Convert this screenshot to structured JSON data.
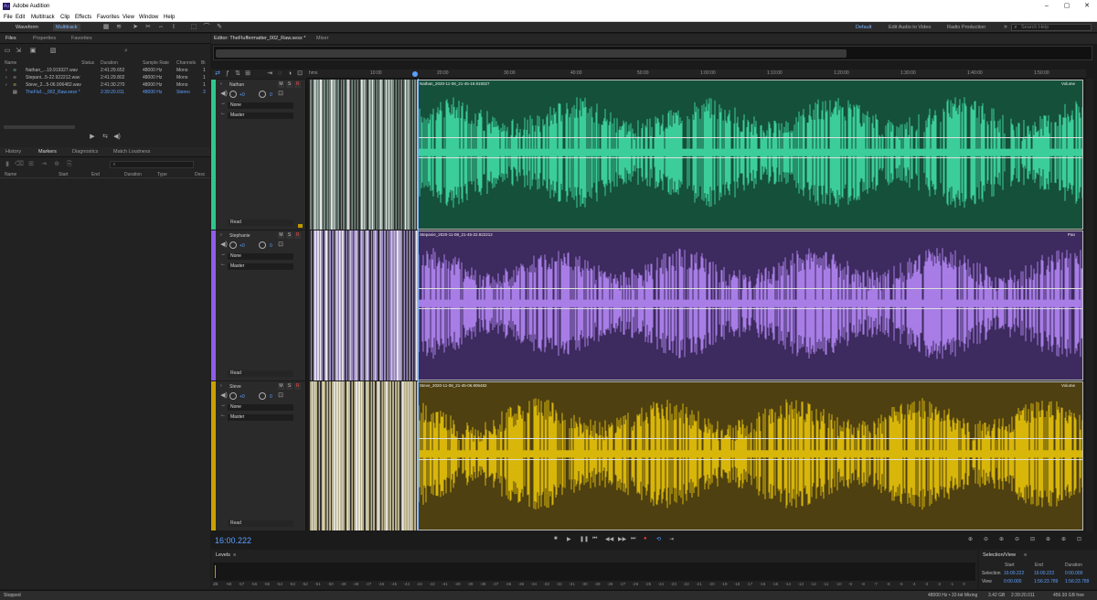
{
  "window": {
    "title": "Adobe Audition",
    "icon": "Au"
  },
  "menu": [
    "File",
    "Edit",
    "Multitrack",
    "Clip",
    "Effects",
    "Favorites",
    "View",
    "Window",
    "Help"
  ],
  "toolbar": {
    "waveform_label": "Waveform",
    "multitrack_label": "Multitrack",
    "workspaces": [
      "Default",
      "Edit Audio to Video",
      "Radio Production"
    ],
    "help_placeholder": "Search Help"
  },
  "files_panel": {
    "tabs": [
      "Files",
      "Properties",
      "Favorites"
    ],
    "columns": [
      "Name",
      "Status",
      "Duration",
      "Sample Rate",
      "Channels",
      "Bi"
    ],
    "rows": [
      {
        "name": "Nathan_...19.919327.wav",
        "duration": "2:41:29.652",
        "rate": "48000 Hz",
        "channels": "Mono",
        "bits": "1"
      },
      {
        "name": "Stepani...5-22.922212.wav",
        "duration": "2:41:29.802",
        "rate": "48000 Hz",
        "channels": "Mono",
        "bits": "1"
      },
      {
        "name": "Steve_2...5-06.906482.wav",
        "duration": "2:41:30.270",
        "rate": "48000 Hz",
        "channels": "Mono",
        "bits": "1"
      },
      {
        "name": "TheFluf..._002_Raw.sesx *",
        "duration": "2:39:20.011",
        "rate": "48000 Hz",
        "channels": "Stereo",
        "bits": "3"
      }
    ]
  },
  "markers_panel": {
    "tabs": [
      "History",
      "Markers",
      "Diagnostics",
      "Match Loudness"
    ],
    "columns": [
      "Name",
      "Start",
      "End",
      "Duration",
      "Type",
      "Desc"
    ]
  },
  "editor": {
    "tabs": [
      "Editor: TheFluffermatter_002_Raw.sesx *",
      "Mixer"
    ],
    "ruler_label": "hms",
    "ruler_ticks": [
      "10:00",
      "20:00",
      "30:00",
      "40:00",
      "50:00",
      "1:00:00",
      "1:10:00",
      "1:20:00",
      "1:30:00",
      "1:40:00",
      "1:50:00"
    ],
    "tracks": [
      {
        "name": "Nathan",
        "m": "M",
        "s": "S",
        "r": "R",
        "vol": "+0",
        "pan": "0",
        "input": "None",
        "output": "Master",
        "read": "Read",
        "color": "#2ec78e",
        "bg": "#15503a",
        "pre_color": "#778a82",
        "wave_color": "#41dca6",
        "clip_name": "Nathan_2020-11-08_21-45-19.919327",
        "clip_tag": "Volume"
      },
      {
        "name": "Stephanie",
        "m": "M",
        "s": "S",
        "r": "R",
        "vol": "+0",
        "pan": "0",
        "input": "None",
        "output": "Master",
        "read": "Read",
        "color": "#8d5ee8",
        "bg": "#3d2a5e",
        "pre_color": "#9a88c0",
        "wave_color": "#b487f5",
        "clip_name": "Stepanie_2020-11-08_21-45-22.922212",
        "clip_tag": "Pan"
      },
      {
        "name": "Steve",
        "m": "M",
        "s": "S",
        "r": "R",
        "vol": "+0",
        "pan": "0",
        "input": "None",
        "output": "Master",
        "read": "Read",
        "color": "#c9a200",
        "bg": "#4e4010",
        "pre_color": "#b9b08a",
        "wave_color": "#e8c40a",
        "clip_name": "Steve_2020-11-08_21-45-06.906482",
        "clip_tag": "Volume"
      }
    ],
    "timecode": "16:00.222"
  },
  "levels": {
    "title": "Levels",
    "scale": [
      "dB",
      "-58",
      "-57",
      "-56",
      "-55",
      "-54",
      "-53",
      "-52",
      "-51",
      "-50",
      "-49",
      "-48",
      "-47",
      "-46",
      "-45",
      "-44",
      "-43",
      "-42",
      "-41",
      "-40",
      "-39",
      "-38",
      "-37",
      "-36",
      "-35",
      "-34",
      "-33",
      "-32",
      "-31",
      "-30",
      "-29",
      "-28",
      "-27",
      "-26",
      "-25",
      "-24",
      "-23",
      "-22",
      "-21",
      "-20",
      "-19",
      "-18",
      "-17",
      "-16",
      "-15",
      "-14",
      "-13",
      "-12",
      "-11",
      "-10",
      "-9",
      "-8",
      "-7",
      "-6",
      "-5",
      "-4",
      "-3",
      "-2",
      "-1",
      "0"
    ]
  },
  "selection_view": {
    "title": "Selection/View",
    "headers": [
      "Start",
      "End",
      "Duration"
    ],
    "selection": [
      "16:00.222",
      "16:00.222",
      "0:00.000"
    ],
    "view": [
      "0:00.000",
      "1:56:23.789",
      "1:56:23.789"
    ],
    "row_labels": [
      "Selection",
      "View"
    ]
  },
  "status": {
    "left": "Stopped",
    "format": "48000 Hz • 32-bit Mixing",
    "size": "3.42 GB",
    "duration": "2:39:20.011",
    "free": "456.93 GB free"
  }
}
